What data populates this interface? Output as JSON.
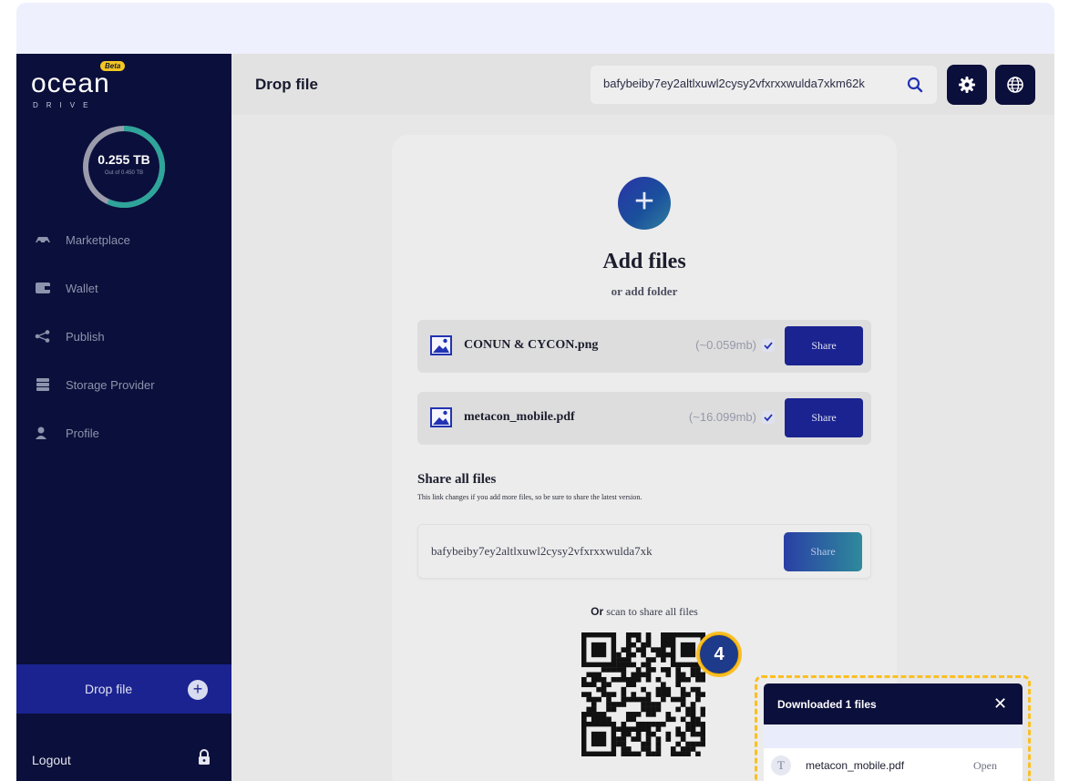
{
  "sidebar": {
    "logo": {
      "word": "ocean",
      "drive": "DRIVE",
      "beta": "Beta"
    },
    "storage": {
      "used": "0.255 TB",
      "total": "Out of 0.450 TB",
      "fraction": 0.567
    },
    "items": [
      {
        "label": "Marketplace",
        "icon": "marketplace-icon"
      },
      {
        "label": "Wallet",
        "icon": "wallet-icon"
      },
      {
        "label": "Publish",
        "icon": "share-icon"
      },
      {
        "label": "Storage Provider",
        "icon": "server-icon"
      },
      {
        "label": "Profile",
        "icon": "user-icon"
      }
    ],
    "drop_file": "Drop file",
    "logout": "Logout"
  },
  "topbar": {
    "title": "Drop file",
    "search_value": "bafybeiby7ey2altlxuwl2cysy2vfxrxxwulda7xkm62k"
  },
  "card": {
    "add_title": "Add files",
    "add_sub": "or add folder",
    "files": [
      {
        "name": "CONUN & CYCON.png",
        "size": "(~0.059mb)",
        "share": "Share"
      },
      {
        "name": "metacon_mobile.pdf",
        "size": "(~16.099mb)",
        "share": "Share"
      }
    ],
    "share_all_title": "Share all files",
    "share_all_desc": "This link changes if you add more files, so be sure to share the latest version.",
    "share_link": "bafybeiby7ey2altlxuwl2cysy2vfxrxxwulda7xk",
    "share_all_button": "Share",
    "scan_or": "Or",
    "scan_text": " scan to share all files"
  },
  "step_badge": "4",
  "toast": {
    "title": "Downloaded 1 files",
    "close": "✕",
    "file_icon_letter": "T",
    "file": "metacon_mobile.pdf",
    "open": "Open"
  },
  "colors": {
    "navy": "#0b0f3b",
    "primary": "#1a2390",
    "highlight": "#fbbf24"
  }
}
